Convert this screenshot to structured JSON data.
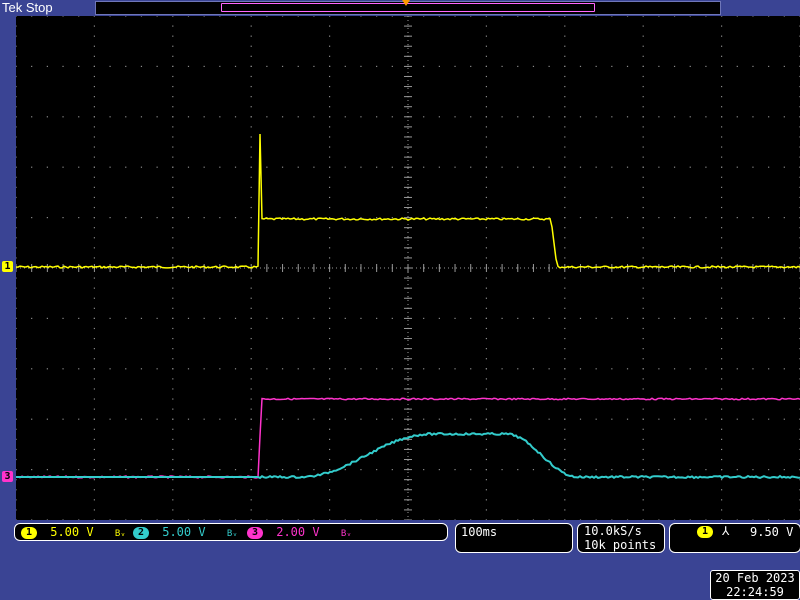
{
  "header": {
    "brand": "Tek",
    "status": "Stop"
  },
  "colors": {
    "ch1": "#ffff00",
    "ch2": "#33cccc",
    "ch3": "#ff33cc",
    "frame": "#3a4494",
    "trigger_marker": "#ff9900"
  },
  "icons": {
    "trigger_position": "trigger-position-arrow-icon",
    "ch1_ground": "channel-1-ground-marker-icon",
    "ch3_ground": "channel-3-ground-marker-icon",
    "bandwidth_limit": "bandwidth-limit-icon",
    "trigger_slope": "falling-edge-slope-icon"
  },
  "markers": {
    "ch1": "1",
    "ch3": "3"
  },
  "vertical": {
    "ch1": {
      "num": "1",
      "scale": "5.00 V",
      "bw": "Bᵥ"
    },
    "ch2": {
      "num": "2",
      "scale": "5.00 V",
      "bw": "Bᵥ"
    },
    "ch3": {
      "num": "3",
      "scale": "2.00 V",
      "bw": "Bᵥ"
    }
  },
  "horizontal": {
    "time_div": "100ms",
    "sample_rate": "10.0kS/s",
    "record_length": "10k points"
  },
  "trigger": {
    "source": "1",
    "slope": "⅄",
    "level": "9.50 V"
  },
  "datetime": {
    "date": "20 Feb  2023",
    "time": "22:24:59"
  }
}
